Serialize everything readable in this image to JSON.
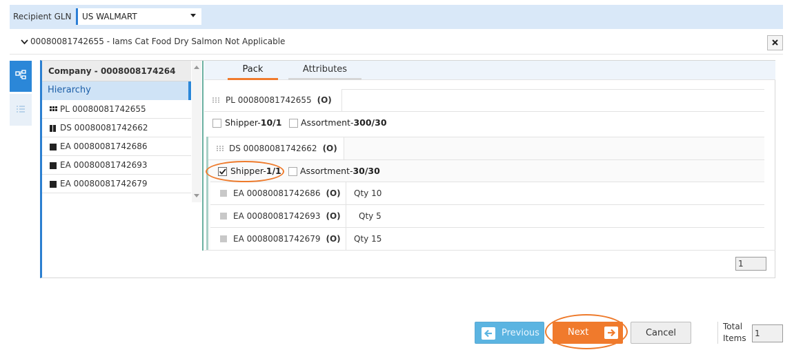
{
  "recipient": {
    "label": "Recipient GLN",
    "selected": "US WALMART"
  },
  "product": {
    "title": "00080081742655 - Iams Cat Food Dry Salmon Not Applicable"
  },
  "tree": {
    "header": "Company - 0008008174264",
    "selected": "Hierarchy",
    "items": [
      {
        "icon": "pallet-icon",
        "label": "PL 00080081742655"
      },
      {
        "icon": "case-icon",
        "label": "DS 00080081742662"
      },
      {
        "icon": "each-icon",
        "label": "EA 00080081742686"
      },
      {
        "icon": "each-icon",
        "label": "EA 00080081742693"
      },
      {
        "icon": "each-icon",
        "label": "EA 00080081742679"
      }
    ]
  },
  "tabs": {
    "pack": "Pack",
    "attributes": "Attributes",
    "active": "Pack"
  },
  "pack": {
    "pl": {
      "gln": "PL 00080081742655",
      "tag": "(O)"
    },
    "pl_options": [
      {
        "label_prefix": "Shipper-",
        "label_value": "10/1",
        "checked": false
      },
      {
        "label_prefix": "Assortment-",
        "label_value": "300/30",
        "checked": false
      }
    ],
    "ds": {
      "gln": "DS 00080081742662",
      "tag": "(O)"
    },
    "ds_options": [
      {
        "label_prefix": "Shipper-",
        "label_value": "1/1",
        "checked": true
      },
      {
        "label_prefix": "Assortment-",
        "label_value": "30/30",
        "checked": false
      }
    ],
    "items": [
      {
        "gln": "EA 00080081742686",
        "tag": "(O)",
        "qty": "Qty 10"
      },
      {
        "gln": "EA 00080081742693",
        "tag": "(O)",
        "qty": "Qty 5"
      },
      {
        "gln": "EA 00080081742679",
        "tag": "(O)",
        "qty": "Qty 15"
      }
    ],
    "page": "1"
  },
  "footer": {
    "previous": "Previous",
    "next": "Next",
    "cancel": "Cancel",
    "total_label": "Total Items",
    "total_value": "1"
  },
  "colors": {
    "accent_blue": "#2b87d8",
    "accent_orange": "#f07a2c",
    "header_bg": "#d9e8f8"
  }
}
